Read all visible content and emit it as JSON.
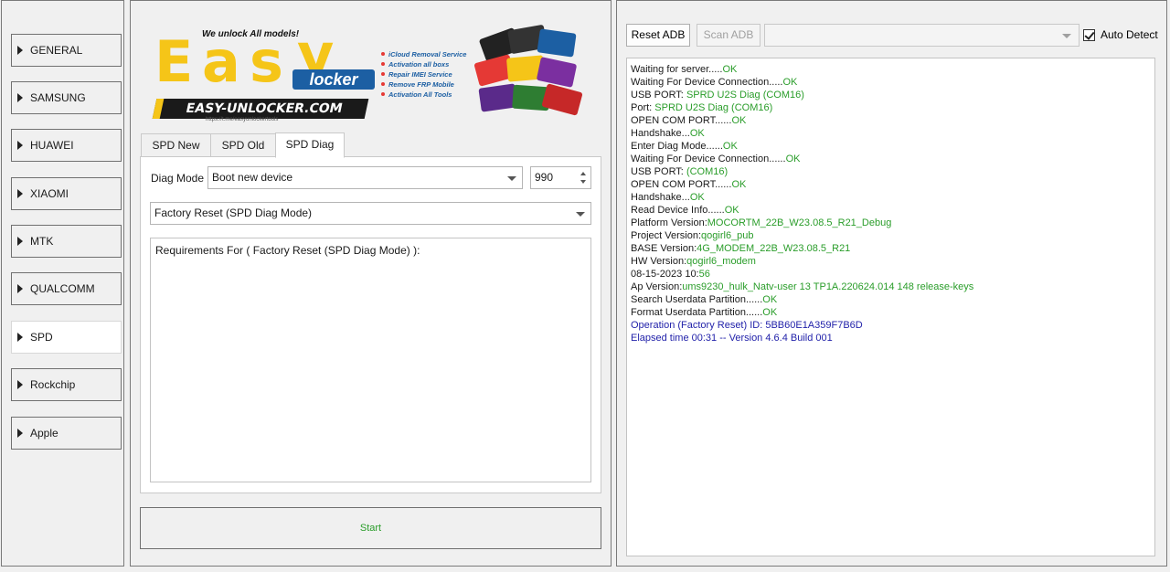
{
  "nav": {
    "items": [
      "GENERAL",
      "SAMSUNG",
      "HUAWEI",
      "XIAOMI",
      "MTK",
      "QUALCOMM",
      "SPD",
      "Rockchip",
      "Apple"
    ],
    "active": "SPD"
  },
  "logo": {
    "tagline": "We unlock All models!",
    "big_text": "Easy",
    "locker": "locker",
    "url": "EASY-UNLOCKER.COM",
    "url_small": "https://t.me/easyunlockertools",
    "services": [
      "iCloud Removal Service",
      "Activation all boxs",
      "Repair IMEI Service",
      "Remove FRP Mobile",
      "Activation All Tools"
    ]
  },
  "tabs": [
    "SPD New",
    "SPD Old",
    "SPD Diag"
  ],
  "active_tab": "SPD Diag",
  "diag": {
    "mode_label": "Diag Mode",
    "mode_value": "Boot new device",
    "port_value": "990",
    "operation_value": "Factory Reset (SPD Diag Mode)",
    "requirements": "Requirements For ( Factory Reset (SPD Diag Mode) ):"
  },
  "start_label": "Start",
  "adb": {
    "reset_label": "Reset ADB",
    "scan_label": "Scan ADB",
    "auto_detect_label": "Auto Detect",
    "auto_detect_checked": true
  },
  "log": [
    {
      "text": "Waiting for server.....",
      "value": "OK",
      "color": "ok"
    },
    {
      "text": "Waiting For Device Connection.....",
      "value": "OK",
      "color": "ok"
    },
    {
      "text": "USB PORT: ",
      "value": "SPRD U2S Diag (COM16)",
      "color": "ok"
    },
    {
      "text": "Port: ",
      "value": "SPRD U2S Diag (COM16)",
      "color": "ok"
    },
    {
      "text": "OPEN COM PORT......",
      "value": "OK",
      "color": "ok"
    },
    {
      "text": "Handshake...",
      "value": "OK",
      "color": "ok"
    },
    {
      "text": "Enter Diag Mode......",
      "value": "OK",
      "color": "ok"
    },
    {
      "text": "Waiting For Device Connection......",
      "value": "OK",
      "color": "ok"
    },
    {
      "text": "USB PORT: ",
      "value": "(COM16)",
      "color": "ok"
    },
    {
      "text": "OPEN COM PORT......",
      "value": "OK",
      "color": "ok"
    },
    {
      "text": "Handshake...",
      "value": "OK",
      "color": "ok"
    },
    {
      "text": "Read Device Info......",
      "value": "OK",
      "color": "ok"
    },
    {
      "text": "Platform Version:",
      "value": "MOCORTM_22B_W23.08.5_R21_Debug",
      "color": "ok"
    },
    {
      "text": "Project Version:",
      "value": "qogirl6_pub",
      "color": "ok"
    },
    {
      "text": "BASE Version:",
      "value": "4G_MODEM_22B_W23.08.5_R21",
      "color": "ok"
    },
    {
      "text": "HW Version:",
      "value": "qogirl6_modem",
      "color": "ok"
    },
    {
      "text": "08-15-2023 10:",
      "value": "56",
      "color": "ok"
    },
    {
      "text": "Ap Version:",
      "value": "ums9230_hulk_Natv-user 13 TP1A.220624.014 148 release-keys",
      "color": "ok"
    },
    {
      "text": "Search Userdata Partition......",
      "value": "OK",
      "color": "ok"
    },
    {
      "text": "Format Userdata Partition......",
      "value": "OK",
      "color": "ok"
    },
    {
      "text": "",
      "value": "Operation (Factory Reset) ID: 5BB60E1A359F7B6D",
      "color": "blue"
    },
    {
      "text": "",
      "value": "Elapsed time 00:31 -- Version 4.6.4 Build 001",
      "color": "blue"
    }
  ]
}
